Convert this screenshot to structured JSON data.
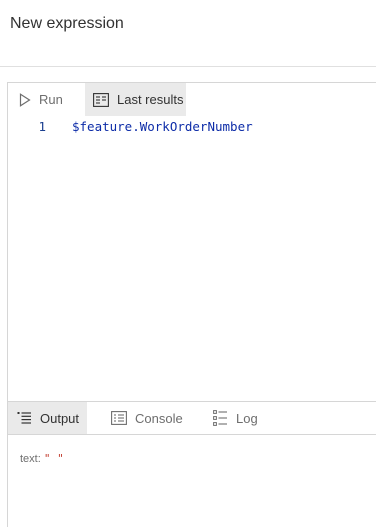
{
  "header": {
    "title": "New expression"
  },
  "toolbar": {
    "run_label": "Run",
    "last_results_label": "Last results"
  },
  "editor": {
    "lines": [
      {
        "number": "1",
        "code": "$feature.WorkOrderNumber"
      }
    ]
  },
  "output_tabs": {
    "output_label": "Output",
    "console_label": "Console",
    "log_label": "Log"
  },
  "result": {
    "key": "text:",
    "value": "\" \""
  },
  "colors": {
    "code_text": "#0d2ca8",
    "active_tab_bg": "#eaeaea",
    "result_value": "#c0392b"
  }
}
